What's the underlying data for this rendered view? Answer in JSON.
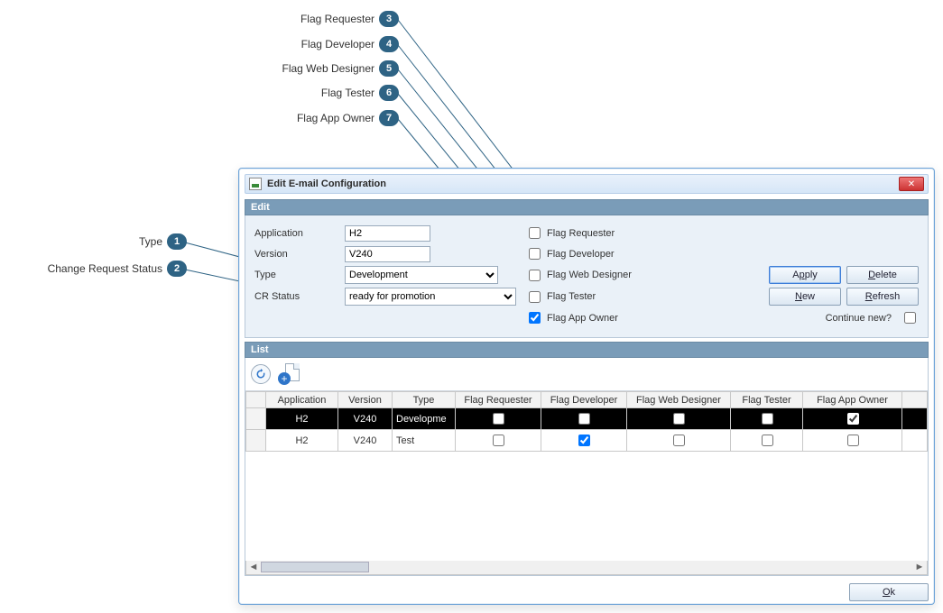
{
  "callouts": {
    "c1": {
      "num": "1",
      "label": "Type"
    },
    "c2": {
      "num": "2",
      "label": "Change Request Status"
    },
    "c3": {
      "num": "3",
      "label": "Flag Requester"
    },
    "c4": {
      "num": "4",
      "label": "Flag Developer"
    },
    "c5": {
      "num": "5",
      "label": "Flag Web Designer"
    },
    "c6": {
      "num": "6",
      "label": "Flag Tester"
    },
    "c7": {
      "num": "7",
      "label": "Flag App Owner"
    }
  },
  "window": {
    "title": "Edit E-mail Configuration"
  },
  "edit": {
    "header": "Edit",
    "labels": {
      "application": "Application",
      "version": "Version",
      "type": "Type",
      "crstatus": "CR Status"
    },
    "values": {
      "application": "H2",
      "version": "V240",
      "type": "Development",
      "crstatus": "ready for promotion"
    },
    "flags": {
      "requester": "Flag Requester",
      "developer": "Flag Developer",
      "webdesigner": "Flag Web Designer",
      "tester": "Flag Tester",
      "appowner": "Flag App Owner"
    },
    "buttons": {
      "apply_pre": "A",
      "apply_ul": "p",
      "apply_post": "ply",
      "delete_pre": "",
      "delete_ul": "D",
      "delete_post": "elete",
      "new_pre": "",
      "new_ul": "N",
      "new_post": "ew",
      "refresh_pre": "",
      "refresh_ul": "R",
      "refresh_post": "efresh",
      "continue": "Continue new?"
    }
  },
  "list": {
    "header": "List",
    "columns": {
      "application": "Application",
      "version": "Version",
      "type": "Type",
      "flag_requester": "Flag Requester",
      "flag_developer": "Flag Developer",
      "flag_webdesigner": "Flag Web Designer",
      "flag_tester": "Flag Tester",
      "flag_appowner": "Flag App Owner"
    },
    "rows": [
      {
        "application": "H2",
        "version": "V240",
        "type": "Developme",
        "fr": false,
        "fd": false,
        "fw": false,
        "ft": false,
        "fa": true,
        "selected": true
      },
      {
        "application": "H2",
        "version": "V240",
        "type": "Test",
        "fr": false,
        "fd": true,
        "fw": false,
        "ft": false,
        "fa": false,
        "selected": false
      }
    ]
  },
  "footer": {
    "ok_pre": "",
    "ok_ul": "O",
    "ok_post": "k"
  }
}
